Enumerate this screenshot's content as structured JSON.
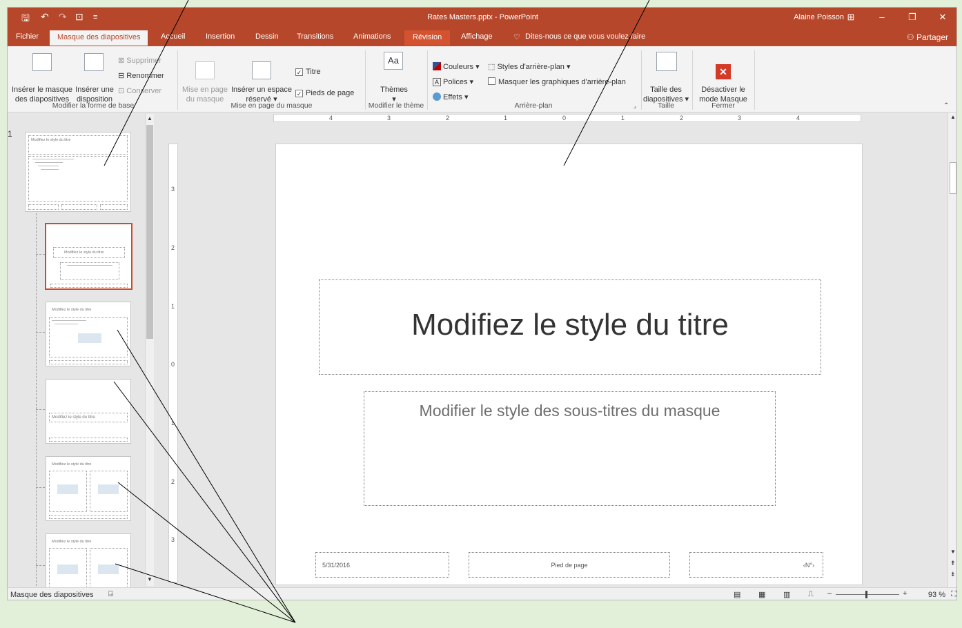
{
  "window": {
    "title": "Rates Masters.pptx - PowerPoint",
    "user": "Alaine Poisson",
    "share_label": "Partager"
  },
  "tabs": [
    "Fichier",
    "Masque des diapositives",
    "Accueil",
    "Insertion",
    "Dessin",
    "Transitions",
    "Animations",
    "Révision",
    "Affichage",
    "Dites-nous ce que vous voulez faire"
  ],
  "ribbon": {
    "insert_master": [
      "Insérer le masque",
      "des diapositives"
    ],
    "insert_layout": [
      "Insérer une",
      "disposition"
    ],
    "delete": "Supprimer",
    "rename": "Renommer",
    "preserve": "Conserver",
    "group_edit_master": "Modifier la forme de base",
    "master_layout": [
      "Mise en page",
      "du masque"
    ],
    "insert_placeholder": [
      "Insérer un espace",
      "réservé"
    ],
    "title_check": "Titre",
    "footers_check": "Pieds de page",
    "group_master_layout": "Mise en page du masque",
    "themes": "Thèmes",
    "group_edit_theme": "Modifier le thème",
    "colors": "Couleurs",
    "fonts": "Polices",
    "effects": "Effets",
    "bg_styles": "Styles d'arrière-plan",
    "hide_bg": "Masquer les graphiques d'arrière-plan",
    "group_background": "Arrière-plan",
    "slide_size": [
      "Taille des",
      "diapositives"
    ],
    "group_size": "Taille",
    "close_master": [
      "Désactiver le",
      "mode Masque"
    ],
    "group_close": "Fermer"
  },
  "thumbs": {
    "number": "1",
    "master_title": "Modifiez le style du titre",
    "layout_title": "Modifiez le style du titre",
    "section_title": "Modifiez le style du titre"
  },
  "ruler": {
    "h": [
      "4",
      "3",
      "2",
      "1",
      "0",
      "1",
      "2",
      "3",
      "4"
    ],
    "v": [
      "3",
      "2",
      "1",
      "0",
      "1",
      "2",
      "3"
    ]
  },
  "slide": {
    "title": "Modifiez le style du titre",
    "subtitle": "Modifier le style des sous-titres du masque",
    "date": "5/31/2016",
    "footer": "Pied de page",
    "number": "‹N°›"
  },
  "status": {
    "view_name": "Masque des diapositives",
    "zoom": "93 %"
  },
  "colors": {
    "accent": "#b7472a",
    "page_bg": "#e2efd9"
  }
}
